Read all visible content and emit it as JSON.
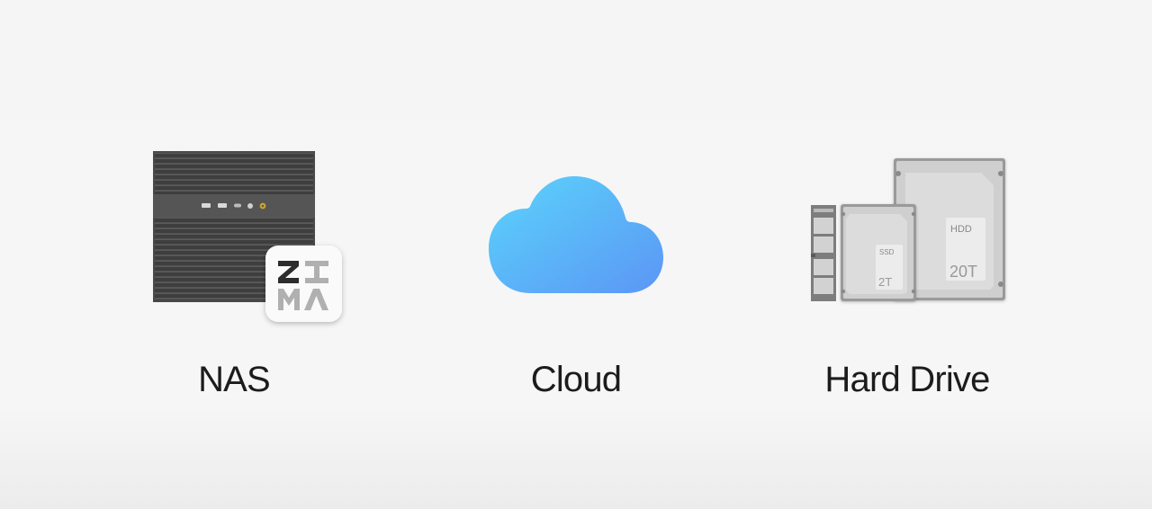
{
  "options": [
    {
      "label": "NAS",
      "icon": "nas-device-icon"
    },
    {
      "label": "Cloud",
      "icon": "cloud-icon"
    },
    {
      "label": "Hard Drive",
      "icon": "hard-drive-icon"
    }
  ],
  "nas_logo_text": "ZIMA",
  "drives": {
    "ssd": {
      "type": "SSD",
      "capacity": "2T"
    },
    "hdd": {
      "type": "HDD",
      "capacity": "20T"
    }
  },
  "colors": {
    "cloud_start": "#5bd4fb",
    "cloud_end": "#5b96f5",
    "nas_body": "#4a4a4a",
    "label_text": "#1c1c1c"
  }
}
